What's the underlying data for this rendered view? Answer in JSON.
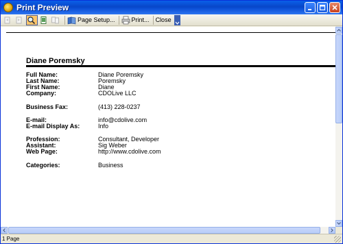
{
  "window": {
    "title": "Print Preview",
    "icon": "app-icon"
  },
  "toolbar": {
    "page_setup_label": "Page Setup...",
    "print_label": "Print...",
    "close_label": "Close"
  },
  "contact": {
    "name_heading": "Diane Poremsky",
    "fields": [
      {
        "label": "Full Name:",
        "value": "Diane Poremsky"
      },
      {
        "label": "Last Name:",
        "value": "Poremsky"
      },
      {
        "label": "First Name:",
        "value": "Diane"
      },
      {
        "label": "Company:",
        "value": "CDOLive LLC"
      },
      {
        "label": "Business Fax:",
        "value": "(413) 228-0237"
      },
      {
        "label": "E-mail:",
        "value": "info@cdolive.com"
      },
      {
        "label": "E-mail Display As:",
        "value": "Info"
      },
      {
        "label": "Profession:",
        "value": "Consultant, Developer"
      },
      {
        "label": "Assistant:",
        "value": "Sig Weber"
      },
      {
        "label": "Web Page:",
        "value": "http://www.cdolive.com"
      },
      {
        "label": "Categories:",
        "value": "Business"
      }
    ]
  },
  "status": {
    "page_count": "1 Page"
  },
  "colors": {
    "titlebar": "#0a5fe8",
    "active_tool": "#ffc66a"
  }
}
